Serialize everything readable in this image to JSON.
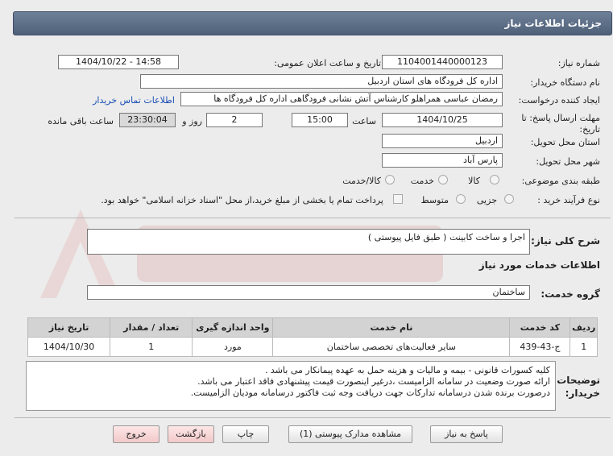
{
  "title": "جزئیات اطلاعات نیاز",
  "fields": {
    "need_number_label": "شماره نیاز:",
    "need_number": "1104001440000123",
    "announce_label": "تاریخ و ساعت اعلان عمومی:",
    "announce_value": "1404/10/22 - 14:58",
    "buyer_org_label": "نام دستگاه خریدار:",
    "buyer_org": "اداره کل فرودگاه های استان اردبیل",
    "requester_label": "ایجاد کننده درخواست:",
    "requester": "رمضان عباسی همراهلو  کارشناس آتش نشانی فرودگاهی اداره کل فرودگاه ها",
    "contact_link": "اطلاعات تماس خریدار",
    "deadline_label": "مهلت ارسال پاسخ: تا تاریخ:",
    "deadline_date": "1404/10/25",
    "time_label": "ساعت",
    "deadline_time": "15:00",
    "days_value": "2",
    "days_label": "روز و",
    "remaining_time": "23:30:04",
    "remaining_label": "ساعت باقی مانده",
    "province_label": "استان محل تحویل:",
    "province": "اردبیل",
    "city_label": "شهر محل تحویل:",
    "city": "پارس آباد",
    "category_label": "طبقه بندی موضوعی:",
    "category_options": [
      "کالا",
      "خدمت",
      "کالا/خدمت"
    ],
    "process_label": "نوع فرآیند خرید :",
    "process_options": [
      "جزیی",
      "متوسط"
    ],
    "payment_note": "پرداخت تمام یا بخشی از مبلغ خرید،از محل \"اسناد خزانه اسلامی\" خواهد بود."
  },
  "summary": {
    "label": "شرح کلی نیاز:",
    "value": "اجرا و ساخت کابینت  ( طبق فایل پیوستی )"
  },
  "services_heading": "اطلاعات خدمات مورد نیاز",
  "service_group": {
    "label": "گروه خدمت:",
    "value": "ساختمان"
  },
  "table": {
    "headers": [
      "ردیف",
      "کد خدمت",
      "نام خدمت",
      "واحد اندازه گیری",
      "تعداد / مقدار",
      "تاریخ نیاز"
    ],
    "rows": [
      [
        "1",
        "ج-43-439",
        "سایر فعالیت‌های تخصصی ساختمان",
        "مورد",
        "1",
        "1404/10/30"
      ]
    ]
  },
  "notes": {
    "label": "توضیحات خریدار:",
    "lines": [
      "کلیه کسورات قانونی - بیمه و مالیات و هزینه حمل به عهده پیمانکار می باشد .",
      "ارائه صورت وضعیت در سامانه الزامیست ،درغیر اینصورت قیمت پیشنهادی فاقد اعتبار می باشد.",
      "درصورت برنده شدن درسامانه تدارکات جهت دریافت وجه ثبت فاکتور درسامانه مودیان الزامیست."
    ]
  },
  "buttons": {
    "reply": "پاسخ به نیاز",
    "attachments": "مشاهده مدارک پیوستی (1)",
    "print": "چاپ",
    "back": "بازگشت",
    "exit": "خروج"
  },
  "colors": {
    "titlebar": "#5a6b85",
    "link": "#1a4fb5",
    "watermark": "#e3b7b7"
  }
}
